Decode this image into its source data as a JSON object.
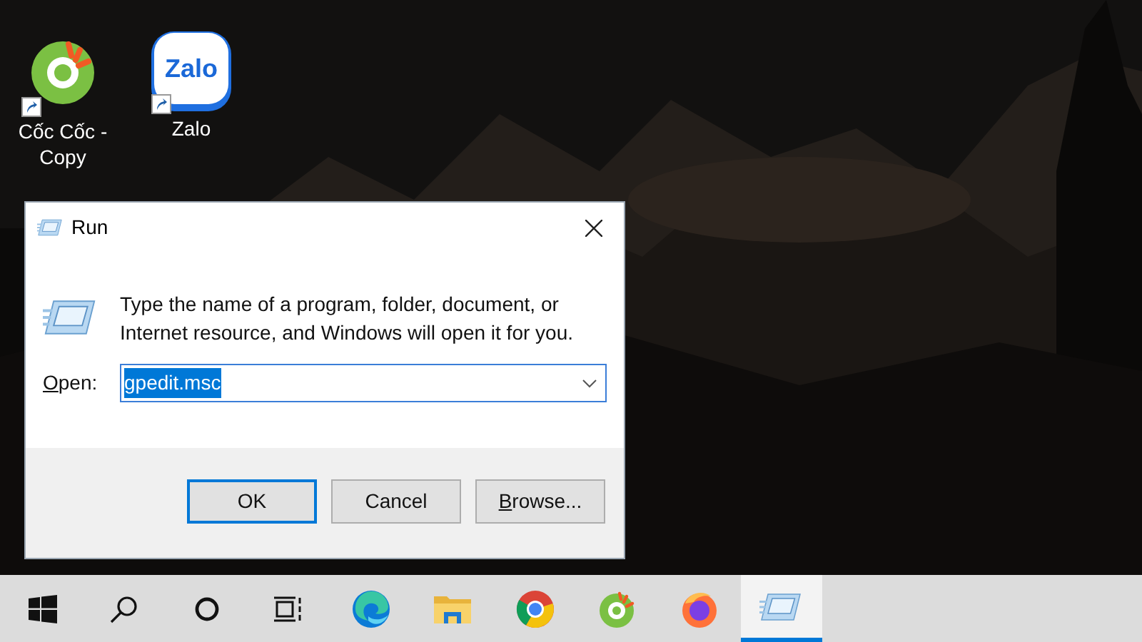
{
  "desktop_icons": [
    {
      "kind": "coccoc",
      "label": "Cốc Cốc - Copy"
    },
    {
      "kind": "zalo",
      "label": "Zalo",
      "logo_text": "Zalo"
    }
  ],
  "dialog": {
    "title": "Run",
    "message": "Type the name of a program, folder, document, or Internet resource, and Windows will open it for you.",
    "open_label": "Open:",
    "open_value": "gpedit.msc",
    "value_selected": true,
    "buttons": [
      {
        "label": "OK",
        "default": true,
        "mnemonic": false
      },
      {
        "label": "Cancel",
        "default": false,
        "mnemonic": false
      },
      {
        "label": "Browse...",
        "default": false,
        "mnemonic": true
      }
    ]
  },
  "taskbar": {
    "items": [
      {
        "kind": "start",
        "active": false
      },
      {
        "kind": "search",
        "active": false
      },
      {
        "kind": "cortana",
        "active": false
      },
      {
        "kind": "taskview",
        "active": false
      },
      {
        "kind": "edge",
        "active": false
      },
      {
        "kind": "explorer",
        "active": false
      },
      {
        "kind": "chrome",
        "active": false
      },
      {
        "kind": "coccoc",
        "active": false
      },
      {
        "kind": "firefox",
        "active": false
      },
      {
        "kind": "run",
        "active": true
      }
    ]
  }
}
